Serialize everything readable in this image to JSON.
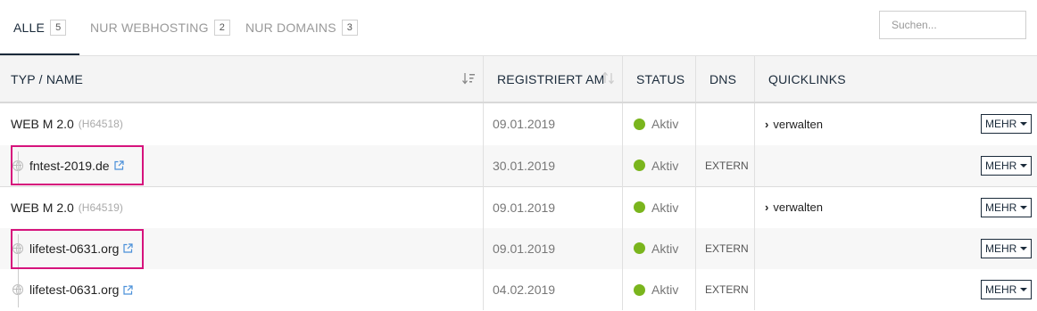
{
  "tabs": [
    {
      "label": "ALLE",
      "count": "5"
    },
    {
      "label": "NUR WEBHOSTING",
      "count": "2"
    },
    {
      "label": "NUR DOMAINS",
      "count": "3"
    }
  ],
  "search": {
    "placeholder": "Suchen..."
  },
  "columns": {
    "name": "TYP / NAME",
    "registered": "REGISTRIERT AM",
    "status": "STATUS",
    "dns": "DNS",
    "quicklinks": "QUICKLINKS"
  },
  "rows": [
    {
      "type": "hosting",
      "name": "WEB M 2.0",
      "id": "(H64518)",
      "date": "09.01.2019",
      "status": "Aktiv",
      "dns": "",
      "quicklink": "verwalten",
      "more": "MEHR"
    },
    {
      "type": "domain",
      "name": "fntest-2019.de",
      "date": "30.01.2019",
      "status": "Aktiv",
      "dns": "EXTERN",
      "quicklink": "",
      "more": "MEHR"
    },
    {
      "type": "hosting",
      "name": "WEB M 2.0",
      "id": "(H64519)",
      "date": "09.01.2019",
      "status": "Aktiv",
      "dns": "",
      "quicklink": "verwalten",
      "more": "MEHR"
    },
    {
      "type": "domain",
      "name": "lifetest-0631.org",
      "date": "09.01.2019",
      "status": "Aktiv",
      "dns": "EXTERN",
      "quicklink": "",
      "more": "MEHR"
    },
    {
      "type": "domain",
      "name": "lifetest-0631.org",
      "date": "04.02.2019",
      "status": "Aktiv",
      "dns": "EXTERN",
      "quicklink": "",
      "more": "MEHR"
    }
  ],
  "colors": {
    "status_active": "#7ab51d",
    "highlight": "#d6137c",
    "accent": "#1a2a3a"
  }
}
